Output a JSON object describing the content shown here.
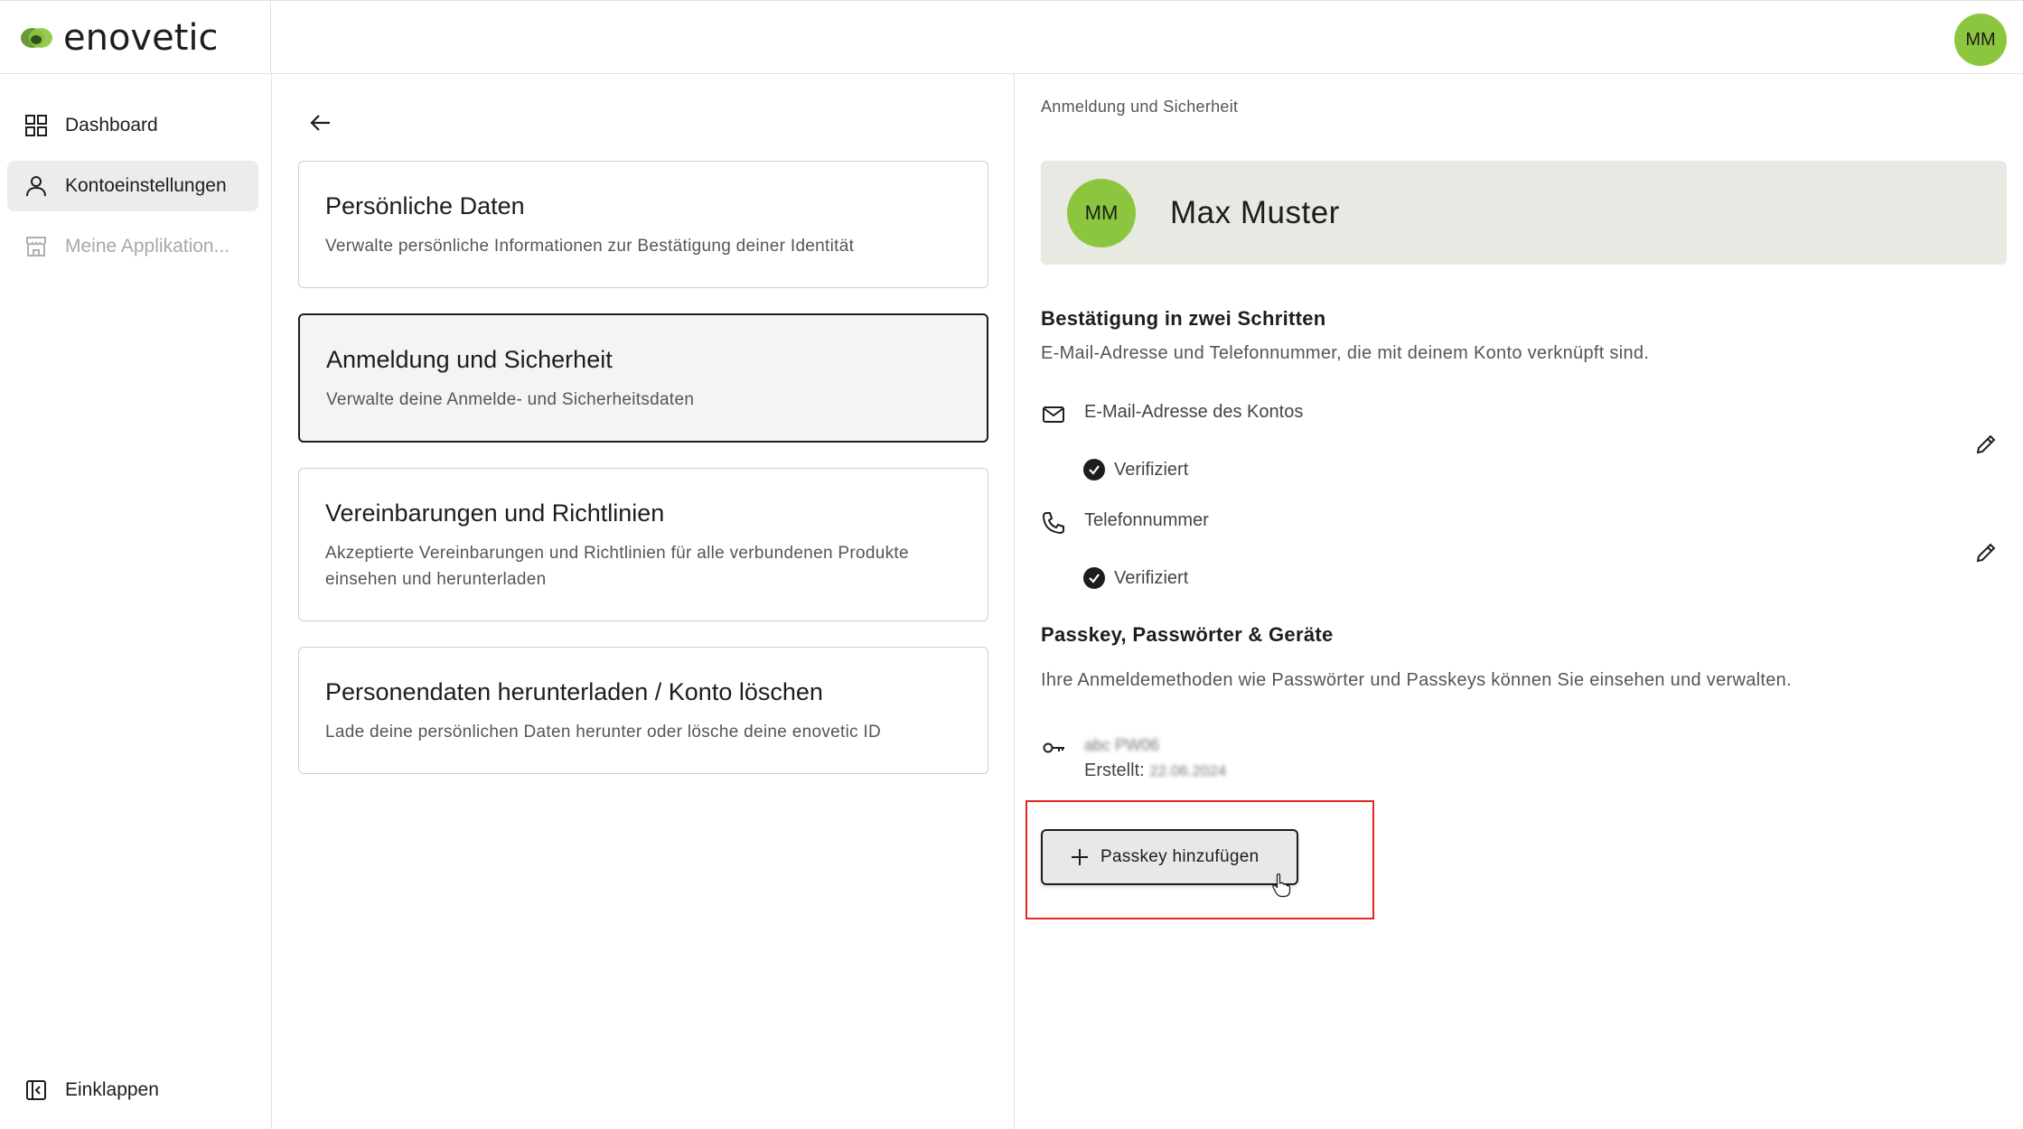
{
  "brand": {
    "name": "enovetic"
  },
  "user": {
    "initials": "MM",
    "name": "Max Muster"
  },
  "colors": {
    "accent": "#8cc63f",
    "highlight": "#e32626",
    "profile_bg": "#e8e9e2"
  },
  "sidebar": {
    "items": [
      {
        "label": "Dashboard",
        "icon": "grid-icon"
      },
      {
        "label": "Kontoeinstellungen",
        "icon": "user-icon",
        "active": true
      },
      {
        "label": "Meine Applikation...",
        "icon": "store-icon",
        "disabled": true
      }
    ],
    "collapse_label": "Einklappen"
  },
  "middle": {
    "cards": [
      {
        "title": "Persönliche Daten",
        "desc": "Verwalte persönliche Informationen zur Bestätigung deiner Identität"
      },
      {
        "title": "Anmeldung und Sicherheit",
        "desc": "Verwalte deine Anmelde- und Sicherheitsdaten",
        "selected": true
      },
      {
        "title": "Vereinbarungen und Richtlinien",
        "desc": "Akzeptierte Vereinbarungen und Richtlinien für alle verbundenen Produkte einsehen und herunterladen"
      },
      {
        "title": "Personendaten herunterladen / Konto löschen",
        "desc": "Lade deine persönlichen Daten herunter oder lösche deine enovetic ID"
      }
    ]
  },
  "right": {
    "breadcrumb": "Anmeldung und Sicherheit",
    "two_step": {
      "title": "Bestätigung in zwei Schritten",
      "desc": "E-Mail-Adresse und Telefonnummer, die mit deinem Konto verknüpft sind.",
      "email_label": "E-Mail-Adresse des Kontos",
      "email_status": "Verifiziert",
      "phone_label": "Telefonnummer",
      "phone_status": "Verifiziert"
    },
    "passkeys": {
      "title": "Passkey, Passwörter & Geräte",
      "desc": "Ihre Anmeldemethoden wie Passwörter und Passkeys können Sie einsehen und verwalten.",
      "item_name": "abc PW06",
      "created_label": "Erstellt:",
      "created_value": "22.06.2024",
      "add_button": "Passkey hinzufügen"
    }
  }
}
